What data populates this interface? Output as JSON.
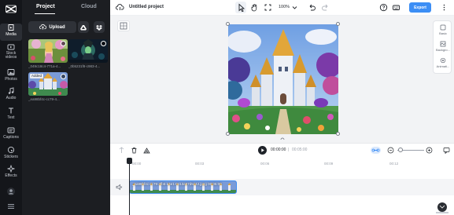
{
  "rail": {
    "items": [
      {
        "label": "Media",
        "icon": "media-icon"
      },
      {
        "label": "Stock videos",
        "icon": "stock-videos-icon"
      },
      {
        "label": "Photos",
        "icon": "photos-icon"
      },
      {
        "label": "Audio",
        "icon": "audio-icon"
      },
      {
        "label": "Text",
        "icon": "text-icon"
      },
      {
        "label": "Captions",
        "icon": "captions-icon"
      },
      {
        "label": "Stickers",
        "icon": "stickers-icon"
      },
      {
        "label": "Effects",
        "icon": "effects-icon"
      }
    ]
  },
  "panel": {
    "tabs": [
      "Project",
      "Cloud"
    ],
    "upload_label": "Upload",
    "media": [
      {
        "caption": "_049c18c4-771a-4...",
        "added": false
      },
      {
        "caption": "_0b5231f8-c983-4...",
        "added": false
      },
      {
        "caption": "_ea98bf4c-cc79-4...",
        "added": true
      }
    ],
    "added_label": "Added"
  },
  "topbar": {
    "title": "Untitled project",
    "zoom": "100%",
    "export_label": "Export"
  },
  "right_tools": [
    {
      "label": "Basic"
    },
    {
      "label": "Backgro..."
    },
    {
      "label": "Animati..."
    }
  ],
  "timeline": {
    "current_time": "00:00:00",
    "separator": "|",
    "total_time": "00:05:00",
    "ruler": [
      "00:00",
      "00:03",
      "00:06",
      "00:09",
      "00:12"
    ],
    "clip_label": "_ea98bf4c-cc79-4fb5-a4e1-0413a67d5c42.jpeg  00:05:00"
  },
  "colors": {
    "accent": "#3c8ef5",
    "rail_bg": "#14161a",
    "panel_bg": "#1c1e22",
    "stage_bg": "#f2f3f5"
  }
}
